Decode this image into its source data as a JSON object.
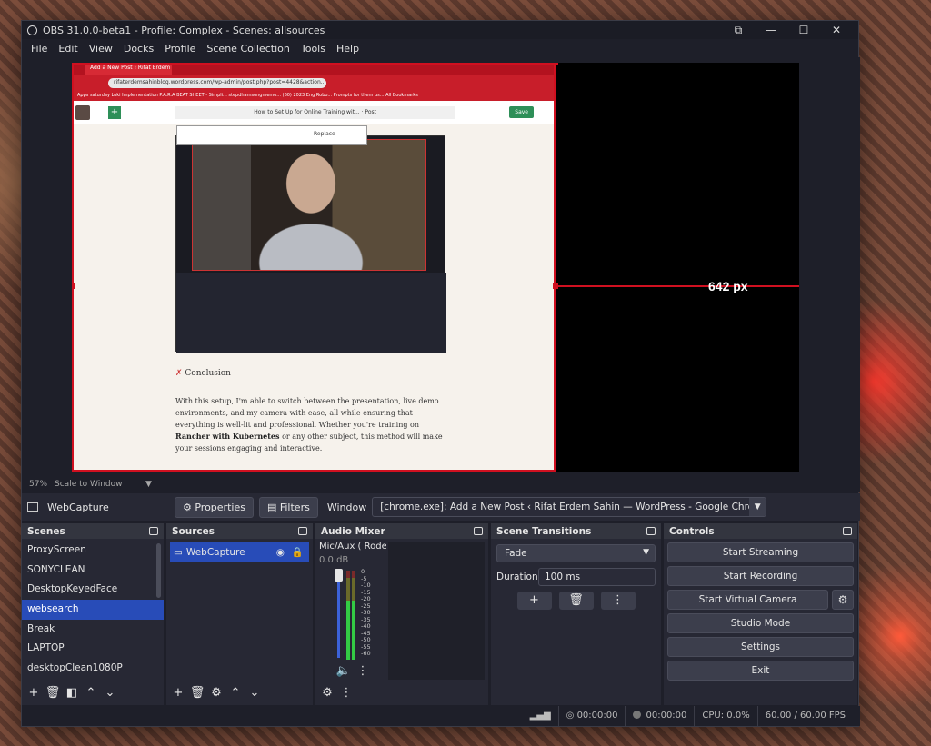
{
  "window": {
    "title": "OBS 31.0.0-beta1 - Profile: Complex - Scenes: allsources",
    "controls": {
      "minimize": "—",
      "maximize": "☐",
      "close": "✕",
      "extra": "⧉"
    }
  },
  "menu": [
    "File",
    "Edit",
    "View",
    "Docks",
    "Profile",
    "Scene Collection",
    "Tools",
    "Help"
  ],
  "preview": {
    "size_label": "642 px",
    "browser": {
      "tab_title": "Add a New Post ‹ Rifat Erdem S...",
      "url": "rifaterdemsahinblog.wordpress.com/wp-admin/post.php?post=4428&action...",
      "bookmarks": "Apps   saturday   Loki Implementation   P.A.R.A   BEAT SHEET - Simpli...   stepdhamsongmemo...   (60) 2023 Eng Robo...   Prompts for them us...   All Bookmarks",
      "doc_title": "How to Set Up for Online Training wit... · Post",
      "save_label": "Save",
      "image_replace": "Replace",
      "conclusion": "Conclusion",
      "paragraph_1": "With this setup, I'm able to switch between the presentation, live demo environments, and my camera with ease, all while ensuring that everything is well-lit and professional. Whether you're training on",
      "paragraph_bold": "Rancher with Kubernetes",
      "paragraph_2": "or any other subject, this method will make your sessions engaging and interactive."
    }
  },
  "preview_status": {
    "zoom": "57%",
    "scale_mode": "Scale to Window",
    "dropdown": "▼"
  },
  "source_bar": {
    "source_name": "WebCapture",
    "properties_label": "Properties",
    "filters_label": "Filters",
    "window_label": "Window",
    "window_value": "[chrome.exe]: Add a New Post ‹ Rifat Erdem Sahin — WordPress - Google Chrome"
  },
  "scenes": {
    "title": "Scenes",
    "items": [
      "ProxyScreen",
      "SONYCLEAN",
      "DesktopKeyedFace",
      "websearch",
      "Break",
      "LAPTOP",
      "desktopClean1080P"
    ],
    "selected_index": 3
  },
  "sources": {
    "title": "Sources",
    "items": [
      {
        "name": "WebCapture",
        "visible": true,
        "locked": true
      }
    ]
  },
  "mixer": {
    "title": "Audio Mixer",
    "track_name": "Mic/Aux ( Rode (",
    "db": "0.0 dB",
    "volume_level": 1.0,
    "meter_level": 0.66,
    "ticks": [
      "0",
      "-5",
      "-10",
      "-15",
      "-20",
      "-25",
      "-30",
      "-35",
      "-40",
      "-45",
      "-50",
      "-55",
      "-60"
    ]
  },
  "transitions": {
    "title": "Scene Transitions",
    "type": "Fade",
    "duration_label": "Duration",
    "duration_value": "100 ms"
  },
  "controls": {
    "title": "Controls",
    "start_streaming": "Start Streaming",
    "start_recording": "Start Recording",
    "start_virtual_camera": "Start Virtual Camera",
    "studio_mode": "Studio Mode",
    "settings": "Settings",
    "exit": "Exit"
  },
  "status": {
    "stream_time": "00:00:00",
    "rec_time": "00:00:00",
    "cpu": "CPU: 0.0%",
    "fps": "60.00 / 60.00 FPS"
  },
  "colors": {
    "accent": "#284cb8",
    "selection_red": "#d01020",
    "panel": "#272834",
    "window_bg": "#1e1f29"
  }
}
